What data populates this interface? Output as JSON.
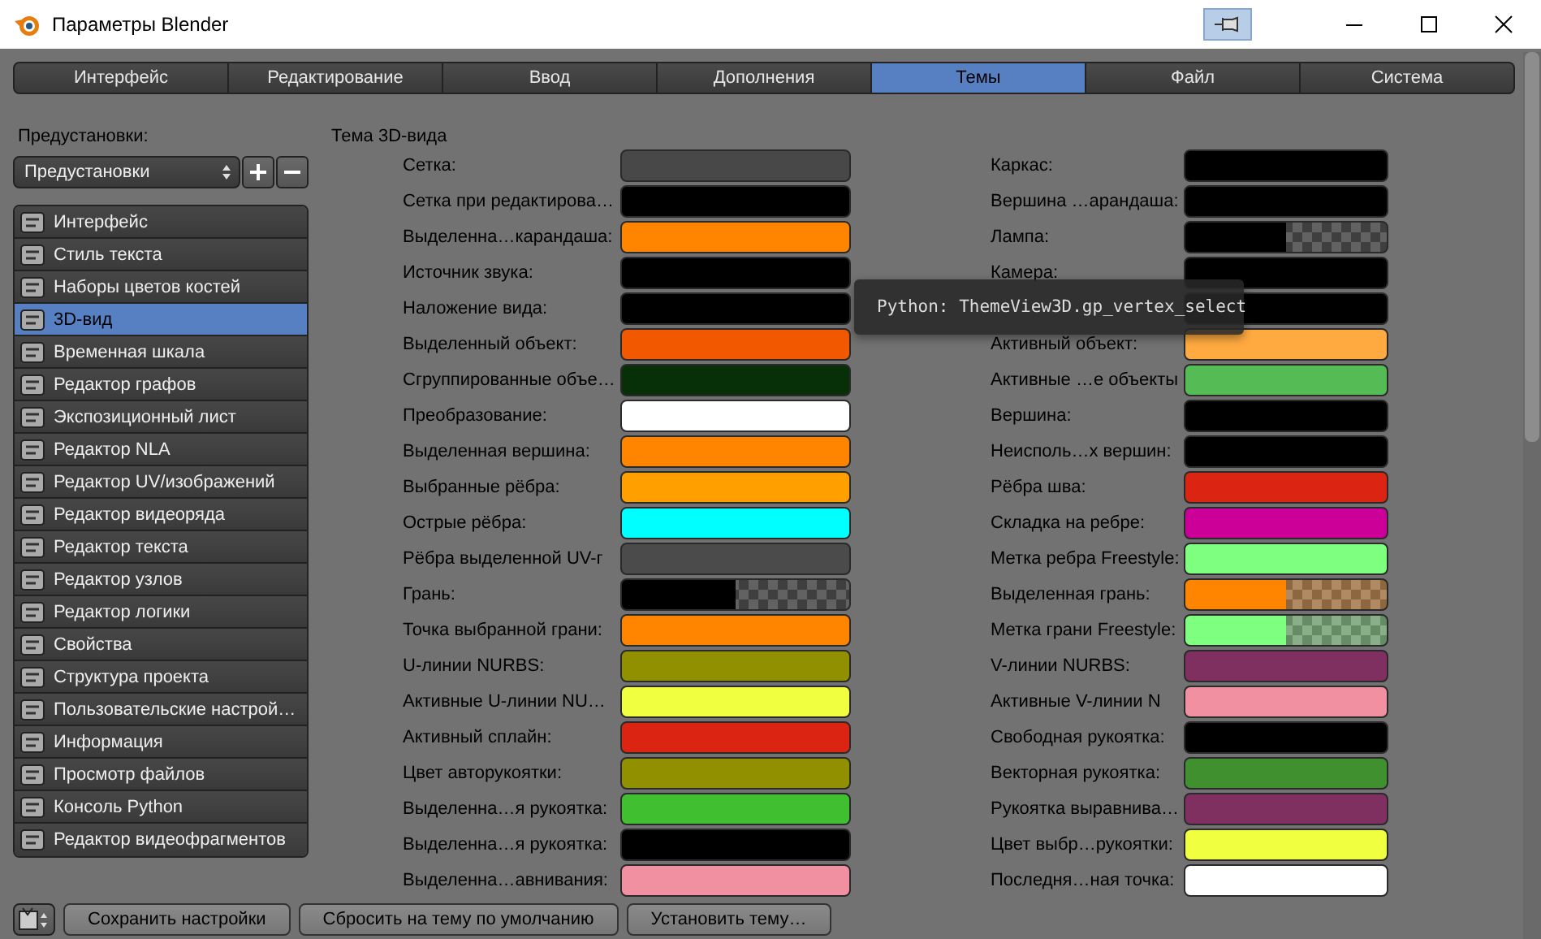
{
  "window": {
    "title": "Параметры Blender"
  },
  "tabs": [
    {
      "label": "Интерфейс",
      "selected": false
    },
    {
      "label": "Редактирование",
      "selected": false
    },
    {
      "label": "Ввод",
      "selected": false
    },
    {
      "label": "Дополнения",
      "selected": false
    },
    {
      "label": "Темы",
      "selected": true
    },
    {
      "label": "Файл",
      "selected": false
    },
    {
      "label": "Система",
      "selected": false
    }
  ],
  "presets": {
    "label": "Предустановки:",
    "value": "Предустановки"
  },
  "sidebar": {
    "items": [
      {
        "label": "Интерфейс",
        "selected": false
      },
      {
        "label": "Стиль текста",
        "selected": false
      },
      {
        "label": "Наборы цветов костей",
        "selected": false
      },
      {
        "label": "3D-вид",
        "selected": true
      },
      {
        "label": "Временная шкала",
        "selected": false
      },
      {
        "label": "Редактор графов",
        "selected": false
      },
      {
        "label": "Экспозиционный лист",
        "selected": false
      },
      {
        "label": "Редактор NLA",
        "selected": false
      },
      {
        "label": "Редактор UV/изображений",
        "selected": false
      },
      {
        "label": "Редактор видеоряда",
        "selected": false
      },
      {
        "label": "Редактор текста",
        "selected": false
      },
      {
        "label": "Редактор узлов",
        "selected": false
      },
      {
        "label": "Редактор логики",
        "selected": false
      },
      {
        "label": "Свойства",
        "selected": false
      },
      {
        "label": "Структура проекта",
        "selected": false
      },
      {
        "label": "Пользовательские настрой…",
        "selected": false
      },
      {
        "label": "Информация",
        "selected": false
      },
      {
        "label": "Просмотр файлов",
        "selected": false
      },
      {
        "label": "Консоль Python",
        "selected": false
      },
      {
        "label": "Редактор видеофрагментов",
        "selected": false
      }
    ]
  },
  "theme": {
    "title": "Тема 3D-вида",
    "left": [
      {
        "label": "Сетка:",
        "color": "#484848",
        "kind": "solid"
      },
      {
        "label": "Сетка при редактирова…",
        "color": "#000000",
        "kind": "solid"
      },
      {
        "label": "Выделенна…карандаша:",
        "color": "#ff8500",
        "kind": "solid"
      },
      {
        "label": "Источник звука:",
        "color": "#000000",
        "kind": "solid"
      },
      {
        "label": "Наложение вида:",
        "color": "#000000",
        "kind": "solid"
      },
      {
        "label": "Выделенный объект:",
        "color": "#f15800",
        "kind": "solid"
      },
      {
        "label": "Сгруппированные объе…",
        "color": "#083008",
        "kind": "solid"
      },
      {
        "label": "Преобразование:",
        "color": "#ffffff",
        "kind": "solid"
      },
      {
        "label": "Выделенная вершина:",
        "color": "#ff8500",
        "kind": "solid"
      },
      {
        "label": "Выбранные рёбра:",
        "color": "#ffa000",
        "kind": "solid"
      },
      {
        "label": "Острые рёбра:",
        "color": "#00ffff",
        "kind": "solid"
      },
      {
        "label": "Рёбра выделенной UV-г",
        "color": "#4b4b4b",
        "kind": "solid"
      },
      {
        "label": "Грань:",
        "color": "#000000",
        "kind": "alpha"
      },
      {
        "label": "Точка выбранной грани:",
        "color": "#ff8500",
        "kind": "solid"
      },
      {
        "label": "U-линии NURBS:",
        "color": "#909000",
        "kind": "solid"
      },
      {
        "label": "Активные U-линии NU…",
        "color": "#f0ff40",
        "kind": "solid"
      },
      {
        "label": "Активный сплайн:",
        "color": "#db2512",
        "kind": "solid"
      },
      {
        "label": "Цвет авторукоятки:",
        "color": "#909000",
        "kind": "solid"
      },
      {
        "label": "Выделенна…я рукоятка:",
        "color": "#40c030",
        "kind": "solid"
      },
      {
        "label": "Выделенна…я рукоятка:",
        "color": "#000000",
        "kind": "solid"
      },
      {
        "label": "Выделенна…авнивания:",
        "color": "#f090a0",
        "kind": "solid"
      }
    ],
    "right": [
      {
        "label": "Каркас:",
        "color": "#000000",
        "kind": "solid"
      },
      {
        "label": "Вершина …арандаша:",
        "color": "#000000",
        "kind": "solid"
      },
      {
        "label": "Лампа:",
        "color": "#000000",
        "kind": "alpha"
      },
      {
        "label": "Камера:",
        "color": "#000000",
        "kind": "solid"
      },
      {
        "color": "#000000",
        "kind": "solid"
      },
      {
        "label": "Активный объект:",
        "color": "#ffaa40",
        "kind": "solid"
      },
      {
        "label": "Активные …е объекты",
        "color": "#55bb55",
        "kind": "solid"
      },
      {
        "label": "Вершина:",
        "color": "#000000",
        "kind": "solid"
      },
      {
        "label": "Неисполь…х вершин:",
        "color": "#000000",
        "kind": "solid"
      },
      {
        "label": "Рёбра шва:",
        "color": "#db2512",
        "kind": "solid"
      },
      {
        "label": "Складка на ребре:",
        "color": "#cc0099",
        "kind": "solid"
      },
      {
        "label": "Метка ребра Freestyle:",
        "color": "#7fff7f",
        "kind": "solid"
      },
      {
        "label": "Выделенная грань:",
        "color": "#ff8500",
        "kind": "alpha"
      },
      {
        "label": "Метка грани Freestyle:",
        "color": "#7fff7f",
        "kind": "alpha"
      },
      {
        "label": "V-линии NURBS:",
        "color": "#803060",
        "kind": "solid"
      },
      {
        "label": "Активные V-линии N",
        "color": "#f090a0",
        "kind": "solid"
      },
      {
        "label": "Свободная рукоятка:",
        "color": "#000000",
        "kind": "solid"
      },
      {
        "label": "Векторная рукоятка:",
        "color": "#409030",
        "kind": "solid"
      },
      {
        "label": "Рукоятка выравнива…",
        "color": "#803060",
        "kind": "solid"
      },
      {
        "label": "Цвет выбр…рукоятки:",
        "color": "#f0ff40",
        "kind": "solid"
      },
      {
        "label": "Последня…ная точка:",
        "color": "#ffffff",
        "kind": "solid"
      }
    ]
  },
  "tooltip": {
    "text": "Python: ThemeView3D.gp_vertex_select"
  },
  "buttons": [
    "Сохранить настройки",
    "Сбросить на тему по умолчанию",
    "Установить тему…"
  ]
}
